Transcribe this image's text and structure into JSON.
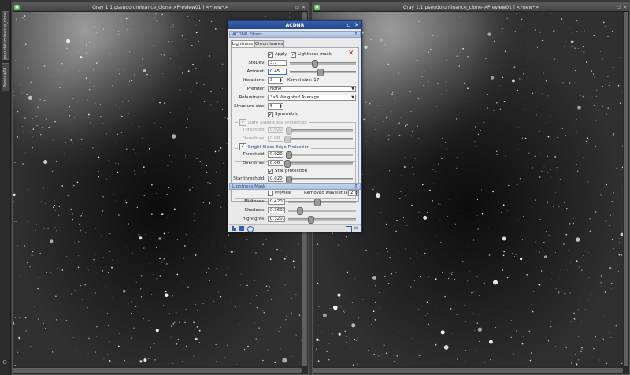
{
  "side_tabs": [
    "pseudoluminance_clone",
    "Preview01"
  ],
  "left_window": {
    "title": "Gray 1:1 pseudoluminance_clone->Preview01 | <*new*>"
  },
  "right_window": {
    "title": "Gray 1:1 pseudoluminance_clone->Preview01 | <*new*>"
  },
  "dialog": {
    "title": "ACDNR",
    "filters_section": "ACDNR Filters",
    "tabs": [
      "Lightness",
      "Chrominance"
    ],
    "apply_label": "Apply",
    "apply_checked": true,
    "lightness_mask_label": "Lightness mask",
    "lightness_mask_checked": true,
    "stddev": {
      "label": "StdDev:",
      "value": "3.7",
      "level": 0.37
    },
    "amount": {
      "label": "Amount:",
      "value": "0.45",
      "level": 0.45
    },
    "iterations": {
      "label": "Iterations:",
      "value": "3"
    },
    "kernel_size": "Kernel size: 17",
    "prefilter": {
      "label": "Prefilter:",
      "value": "None"
    },
    "robustness": {
      "label": "Robustness:",
      "value": "3x3 Weighted Average"
    },
    "structure_size": {
      "label": "Structure size:",
      "value": "5"
    },
    "symmetric": {
      "label": "Symmetric",
      "checked": true
    },
    "dark_group": {
      "title": "Dark Sides Edge Protection",
      "checked": true,
      "enabled": false,
      "threshold": {
        "label": "Threshold:",
        "value": "0.020",
        "level": 0.02
      },
      "overdrive": {
        "label": "Overdrive:",
        "value": "0.00",
        "level": 0.0
      }
    },
    "bright_group": {
      "title": "Bright Sides Edge Protection",
      "checked": true,
      "threshold": {
        "label": "Threshold:",
        "value": "0.020",
        "level": 0.02
      },
      "overdrive": {
        "label": "Overdrive:",
        "value": "0.00",
        "level": 0.0
      },
      "star_protection": {
        "label": "Star protection",
        "checked": true
      },
      "star_threshold": {
        "label": "Star threshold:",
        "value": "0.020",
        "level": 0.02
      }
    },
    "mask_section": "Lightness Mask",
    "preview": {
      "label": "Preview",
      "checked": false
    },
    "removed_layers": {
      "label": "Removed wavelet layers:",
      "value": "2"
    },
    "midtones": {
      "label": "Midtones:",
      "value": "0.42000",
      "level": 0.42
    },
    "shadows": {
      "label": "Shadows:",
      "value": "0.16000",
      "level": 0.16
    },
    "highlights": {
      "label": "Highlights:",
      "value": "0.32000",
      "level": 0.32
    }
  },
  "icons": [
    "view-icon",
    "close-icon",
    "collapse-icon",
    "reset-icon",
    "new-instance-icon",
    "apply-icon",
    "apply-global-icon",
    "preview-icon"
  ],
  "colors": {
    "dialog_title": "#2f52a0",
    "section": "#c3d2ea",
    "reset_x": "#d21e1e"
  }
}
